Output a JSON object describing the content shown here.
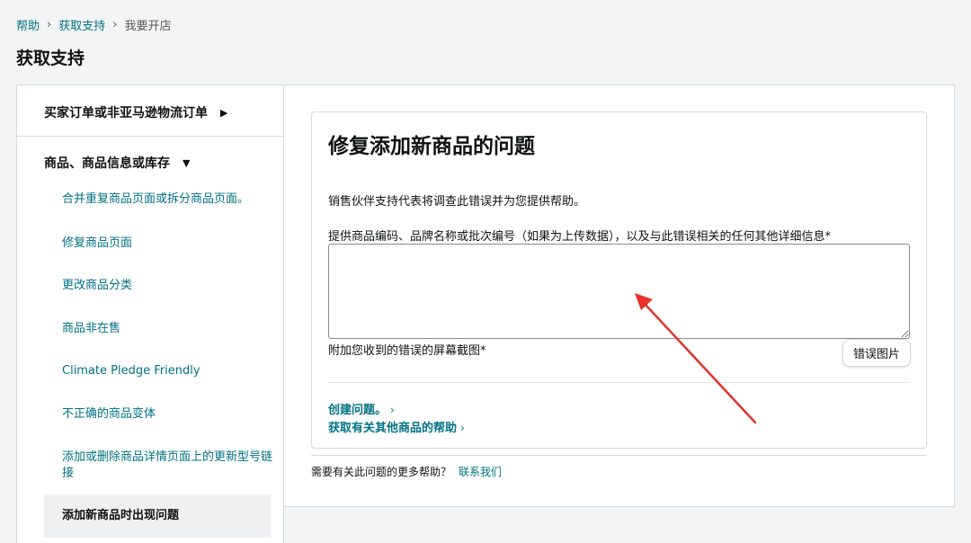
{
  "breadcrumb": {
    "items": [
      "帮助",
      "获取支持",
      "我要开店"
    ],
    "separator": "›"
  },
  "page_title": "获取支持",
  "sidebar": {
    "sections": [
      {
        "label": "买家订单或非亚马逊物流订单",
        "indicator": "▶"
      },
      {
        "label": "商品、商品信息或库存",
        "indicator": "▼"
      }
    ],
    "items": [
      {
        "label": "合并重复商品页面或拆分商品页面。"
      },
      {
        "label": "修复商品页面"
      },
      {
        "label": "更改商品分类"
      },
      {
        "label": "商品非在售"
      },
      {
        "label": "Climate Pledge Friendly"
      },
      {
        "label": "不正确的商品变体"
      },
      {
        "label": "添加或删除商品详情页面上的更新型号链接"
      },
      {
        "label": "添加新商品时出现问题",
        "selected": true
      }
    ]
  },
  "form": {
    "title": "修复添加新商品的问题",
    "description": "销售伙伴支持代表将调查此错误并为您提供帮助。",
    "details_label": "提供商品编码、品牌名称或批次编号（如果为上传数据），以及与此错误相关的任何其他详细信息*",
    "details_value": "",
    "screenshot_label": "附加您收到的错误的屏幕截图*",
    "upload_button": "错误图片",
    "create_case_link": "创建问题。",
    "other_help_link": "获取有关其他商品的帮助",
    "link_chevron": "›"
  },
  "footer": {
    "question": "需要有关此问题的更多帮助？",
    "contact_link": "联系我们"
  },
  "colors": {
    "link": "#007185",
    "text": "#0f1111",
    "annotation_arrow": "#e8312c"
  },
  "icons": {
    "separator": "chevron-right-icon",
    "expand": "triangle-right-icon",
    "collapse": "triangle-down-icon",
    "arrow": "red-annotation-arrow"
  }
}
